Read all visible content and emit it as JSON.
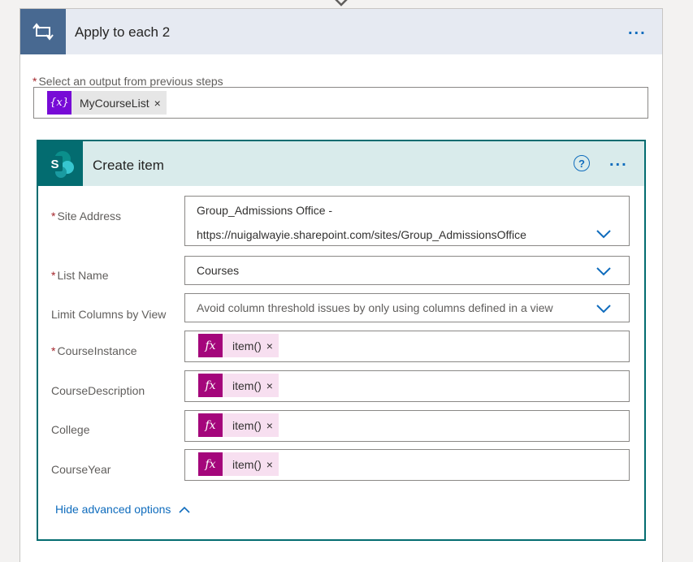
{
  "apply_each": {
    "title": "Apply to each 2",
    "more_label": "...",
    "select_label": "Select an output from previous steps",
    "required_mark": "*",
    "token": {
      "icon_text": "{x}",
      "label": "MyCourseList",
      "remove": "×"
    }
  },
  "create_item": {
    "title": "Create item",
    "help_label": "?",
    "more_label": "...",
    "fields": {
      "site_address": {
        "label": "Site Address",
        "value_line1": "Group_Admissions Office -",
        "value_line2": "https://nuigalwayie.sharepoint.com/sites/Group_AdmissionsOffice"
      },
      "list_name": {
        "label": "List Name",
        "value": "Courses"
      },
      "limit_columns": {
        "label": "Limit Columns by View",
        "value": "Avoid column threshold issues by only using columns defined in a view"
      },
      "course_instance": {
        "label": "CourseInstance",
        "token_icon": "fx",
        "token_label": "item()",
        "remove": "×"
      },
      "course_description": {
        "label": "CourseDescription",
        "token_icon": "fx",
        "token_label": "item()",
        "remove": "×"
      },
      "college": {
        "label": "College",
        "token_icon": "fx",
        "token_label": "item()",
        "remove": "×"
      },
      "course_year": {
        "label": "CourseYear",
        "token_icon": "fx",
        "token_label": "item()",
        "remove": "×"
      }
    },
    "advanced_link": "Hide advanced options"
  },
  "icons": [
    "connector-arrow-icon",
    "loop-icon",
    "variable-icon",
    "sharepoint-icon",
    "help-icon",
    "chevron-down-icon",
    "expression-icon",
    "chevron-up-icon"
  ],
  "colors": {
    "loop_accent": "#486991",
    "sharepoint_accent": "#036c70",
    "variable_token": "#770bd6",
    "expression_token": "#a4067b",
    "link": "#0f6cbd"
  }
}
